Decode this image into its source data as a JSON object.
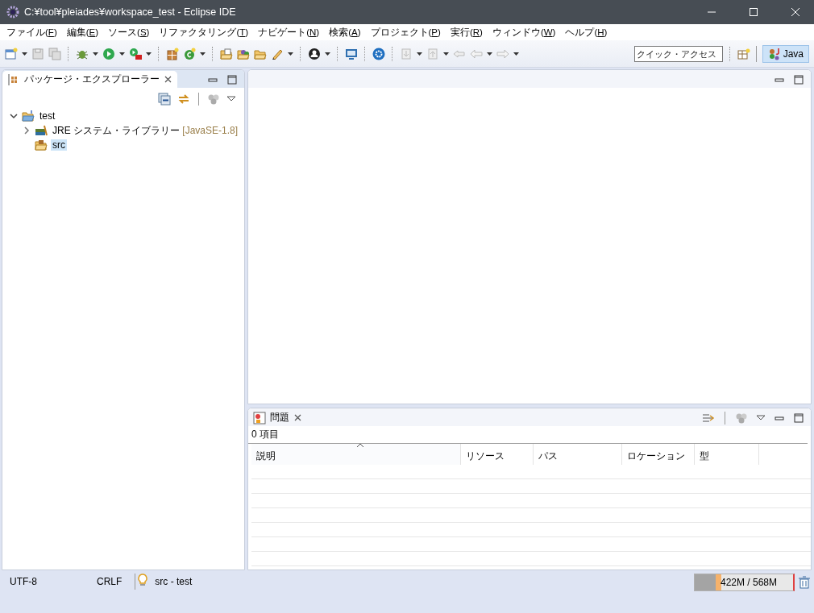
{
  "window": {
    "title": "C:¥tool¥pleiades¥workspace_test - Eclipse IDE"
  },
  "menu": [
    {
      "before": "ファイル(",
      "key": "F",
      "after": ")"
    },
    {
      "before": "編集(",
      "key": "E",
      "after": ")"
    },
    {
      "before": "ソース(",
      "key": "S",
      "after": ")"
    },
    {
      "before": "リファクタリング(",
      "key": "T",
      "after": ")"
    },
    {
      "before": "ナビゲート(",
      "key": "N",
      "after": ")"
    },
    {
      "before": "検索(",
      "key": "A",
      "after": ")"
    },
    {
      "before": "プロジェクト(",
      "key": "P",
      "after": ")"
    },
    {
      "before": "実行(",
      "key": "R",
      "after": ")"
    },
    {
      "before": "ウィンドウ(",
      "key": "W",
      "after": ")"
    },
    {
      "before": "ヘルプ(",
      "key": "H",
      "after": ")"
    }
  ],
  "toolbar": {
    "quick_access": {
      "placeholder": "クイック・アクセス"
    },
    "perspectives": [
      {
        "label": "Java",
        "selected": true
      }
    ]
  },
  "explorer": {
    "tab": {
      "label": "パッケージ・エクスプローラー",
      "selected": true
    },
    "tree": [
      {
        "label": "test",
        "kind": "project",
        "expanded": true,
        "selected": false,
        "children": [
          {
            "label": "JRE システム・ライブラリー",
            "decoration": "[JavaSE-1.8]",
            "kind": "library",
            "expanded": false,
            "selected": false
          },
          {
            "label": "src",
            "kind": "source-folder",
            "selected": true
          }
        ]
      }
    ]
  },
  "problems": {
    "tab": {
      "label": "問題",
      "selected": false
    },
    "summary": "0 項目",
    "columns": [
      {
        "label": "説明",
        "sorted": true
      },
      {
        "label": "リソース",
        "sorted": false
      },
      {
        "label": "パス",
        "sorted": false
      },
      {
        "label": "ロケーション",
        "sorted": false
      },
      {
        "label": "型",
        "sorted": false
      }
    ]
  },
  "status_bar": {
    "encoding": "UTF-8",
    "line_delimiter": "CRLF",
    "selection": "src - test",
    "heap": {
      "reading": "422M / 568M",
      "level": 0.27
    }
  }
}
